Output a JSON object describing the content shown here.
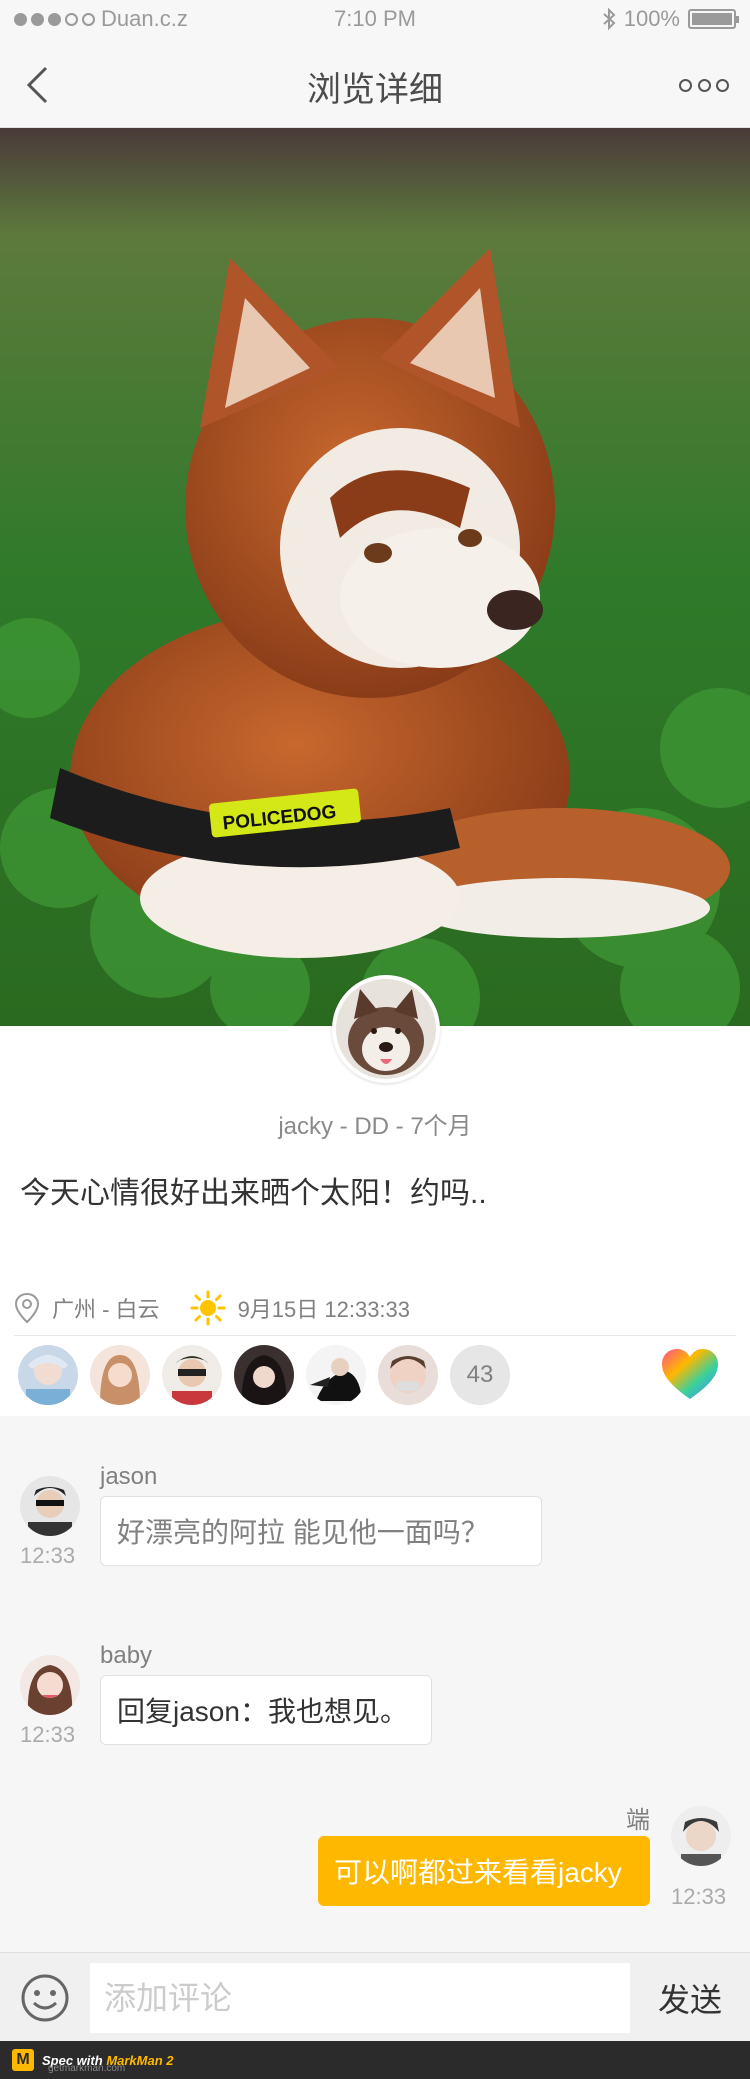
{
  "status_bar": {
    "carrier": "Duan.c.z",
    "time": "7:10 PM",
    "battery": "100%",
    "battery_level": 1.0
  },
  "nav": {
    "title": "浏览详细",
    "back_icon": "chevron-left-icon",
    "more_icon": "more-dots-icon"
  },
  "post": {
    "author_line": "jacky - DD - 7个月",
    "text": "今天心情很好出来晒个太阳！约吗..",
    "location": "广州 - 白云",
    "datetime": "9月15日 12:33:33",
    "like_count": "43"
  },
  "comments": [
    {
      "name": "jason",
      "time": "12:33",
      "text": "好漂亮的阿拉 能见他一面吗？"
    },
    {
      "name": "baby",
      "time": "12:33",
      "text": "回复jason：我也想见。"
    },
    {
      "name": "端",
      "time": "12:33",
      "text": "可以啊都过来看看jacky"
    }
  ],
  "input_bar": {
    "placeholder": "添加评论",
    "send_label": "发送"
  },
  "footer": {
    "spec_with": "Spec with",
    "brand": "MarkMan 2",
    "url": "getmarkman.com"
  },
  "colors": {
    "accent": "#ffb800",
    "title": "#4c4c4c",
    "secondary": "#808080",
    "body": "#333333",
    "placeholder": "#cccccc"
  }
}
